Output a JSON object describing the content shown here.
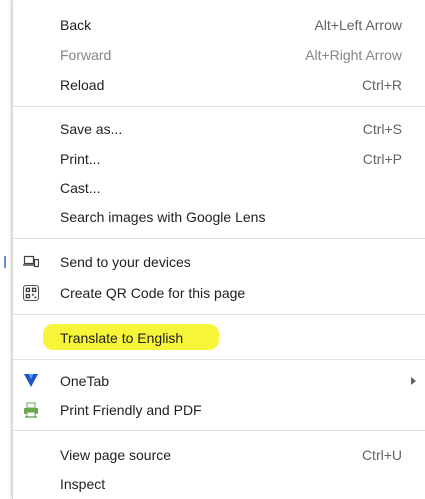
{
  "menu": {
    "items": [
      {
        "label": "Back",
        "shortcut": "Alt+Left Arrow"
      },
      {
        "label": "Forward",
        "shortcut": "Alt+Right Arrow"
      },
      {
        "label": "Reload",
        "shortcut": "Ctrl+R"
      },
      {
        "label": "Save as...",
        "shortcut": "Ctrl+S"
      },
      {
        "label": "Print...",
        "shortcut": "Ctrl+P"
      },
      {
        "label": "Cast..."
      },
      {
        "label": "Search images with Google Lens"
      },
      {
        "label": "Send to your devices",
        "icon": "send-to-device-icon"
      },
      {
        "label": "Create QR Code for this page",
        "icon": "qr-code-icon"
      },
      {
        "label": "Translate to English"
      },
      {
        "label": "OneTab",
        "icon": "onetab-icon"
      },
      {
        "label": "Print Friendly and PDF",
        "icon": "print-friendly-icon"
      },
      {
        "label": "View page source",
        "shortcut": "Ctrl+U"
      },
      {
        "label": "Inspect"
      }
    ],
    "highlight_color": "#f7f53a"
  }
}
